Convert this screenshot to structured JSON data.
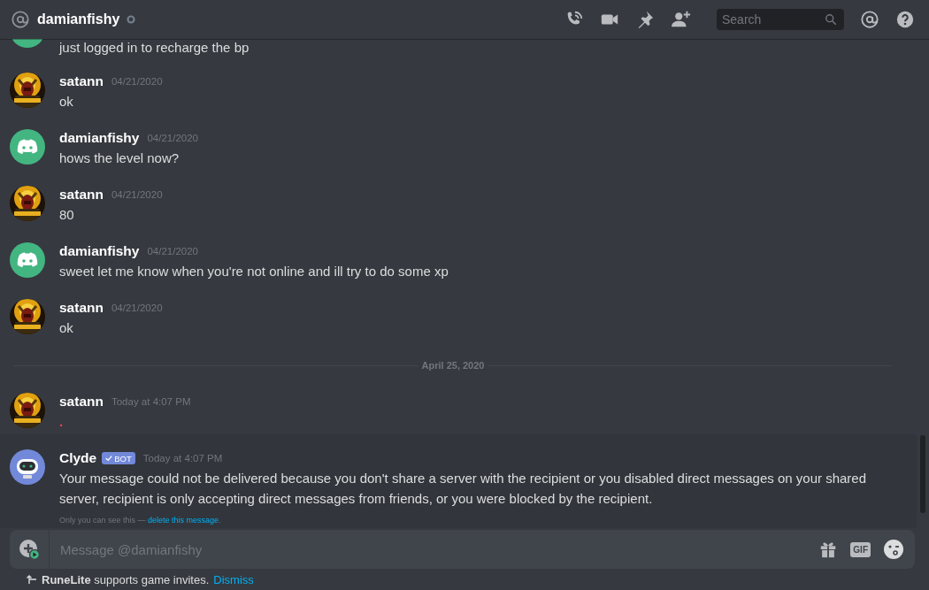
{
  "header": {
    "channel": "damianfishy",
    "search": {
      "placeholder": "Search"
    }
  },
  "messages": [
    {
      "kind": "continuation",
      "text": "just logged in to recharge the bp"
    },
    {
      "kind": "message",
      "author": "satann",
      "timestamp": "04/21/2020",
      "text": "ok",
      "highlighted": false
    },
    {
      "kind": "message",
      "avatar": {
        "kind": "discord"
      },
      "author": "damianfishy",
      "timestamp": "04/21/2020",
      "text": "hows the level now?",
      "highlighted": false
    },
    {
      "kind": "message",
      "author": "satann",
      "timestamp": "04/21/2020",
      "text": "80",
      "highlighted": false
    },
    {
      "kind": "message",
      "avatar": {
        "kind": "discord"
      },
      "author": "damianfishy",
      "timestamp": "04/21/2020",
      "text": "sweet let me know when you're not online and ill try to do some xp",
      "highlighted": false
    },
    {
      "kind": "message",
      "author": "satann",
      "timestamp": "04/21/2020",
      "text": "ok",
      "highlighted": false
    },
    {
      "kind": "divider",
      "label": "April 25, 2020"
    },
    {
      "kind": "message",
      "author": "satann",
      "timestamp": "Today at 4:07 PM",
      "text": ".",
      "color": "#e0474e",
      "highlighted": false
    },
    {
      "kind": "message",
      "avatar": {
        "kind": "bot"
      },
      "author": "Clyde",
      "badge": "BOT",
      "timestamp": "Today at 4:07 PM",
      "text": "Your message could not be delivered because you don't share a server with the recipient or you disabled direct messages on your shared server, recipient is only accepting direct messages from friends, or you were blocked by the recipient.",
      "note": "Only you can see this —",
      "note_link": "delete this message",
      "note_end": ".",
      "highlighted": true
    }
  ],
  "composer": {
    "placeholder": "Message @damianfishy",
    "gif_label": "GIF"
  },
  "notice": {
    "text": "**RuneLite** supports game invites.",
    "action": "Dismiss"
  }
}
